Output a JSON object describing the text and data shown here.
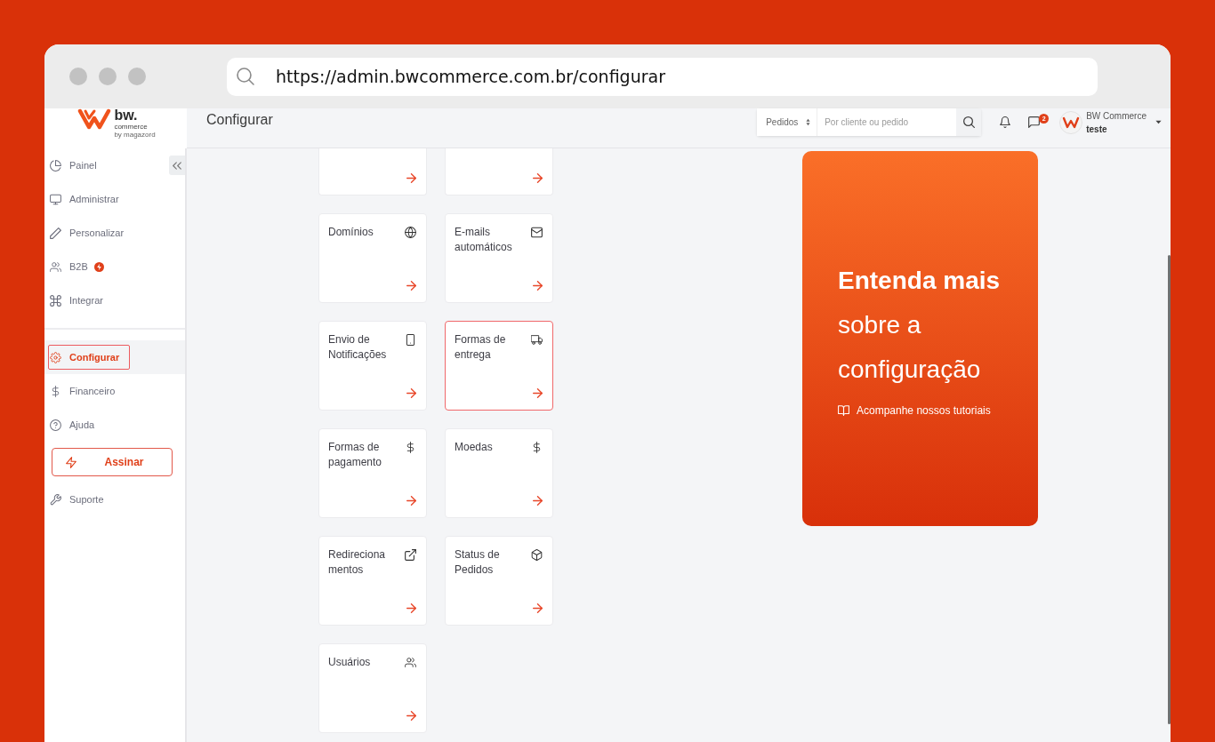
{
  "browser": {
    "url": "https://admin.bwcommerce.com.br/configurar"
  },
  "sidebar": {
    "logo": {
      "wordmark": "bw.",
      "subtitle": "commerce",
      "tagline": "by magazord"
    },
    "sections": [
      {
        "items": [
          {
            "label": "Painel",
            "selected": false,
            "highlighted": false,
            "badge": false
          },
          {
            "label": "Administrar",
            "selected": false,
            "highlighted": false,
            "badge": false
          },
          {
            "label": "Personalizar",
            "selected": false,
            "highlighted": false,
            "badge": false
          },
          {
            "label": "B2B",
            "selected": false,
            "highlighted": false,
            "badge": true
          },
          {
            "label": "Integrar",
            "selected": false,
            "highlighted": false,
            "badge": false
          }
        ]
      },
      {
        "items": [
          {
            "label": "Configurar",
            "selected": true,
            "highlighted": true,
            "badge": false
          },
          {
            "label": "Financeiro",
            "selected": false,
            "highlighted": false,
            "badge": false
          },
          {
            "label": "Ajuda",
            "selected": false,
            "highlighted": false,
            "badge": false
          }
        ]
      }
    ],
    "subscribe_button": "Assinar",
    "footer_items": [
      {
        "label": "Suporte",
        "selected": false,
        "highlighted": false,
        "badge": false
      }
    ]
  },
  "header": {
    "title": "Configurar",
    "search": {
      "scope": "Pedidos",
      "placeholder": "Por cliente ou pedido"
    },
    "messages_badge": "2",
    "account": {
      "name": "BW Commerce",
      "user": "teste"
    }
  },
  "cards": [
    {
      "kind": "clipped",
      "highlighted": false
    },
    {
      "kind": "clipped",
      "highlighted": false
    },
    {
      "kind": "full",
      "title": "Domínios",
      "highlighted": false
    },
    {
      "kind": "full",
      "title": "E-mails automáticos",
      "highlighted": false
    },
    {
      "kind": "full",
      "title": "Envio de Notificações",
      "highlighted": false
    },
    {
      "kind": "full",
      "title": "Formas de entrega",
      "highlighted": true
    },
    {
      "kind": "full",
      "title": "Formas de pagamento",
      "highlighted": false
    },
    {
      "kind": "full",
      "title": "Moedas",
      "highlighted": false
    },
    {
      "kind": "full",
      "title": "Redirecionamentos",
      "highlighted": false
    },
    {
      "kind": "full",
      "title": "Status de Pedidos",
      "highlighted": false
    },
    {
      "kind": "full",
      "title": "Usuários",
      "highlighted": false
    }
  ],
  "promo": {
    "headline": "**Entenda mais** sobre a configuração",
    "link": "Acompanhe nossos tutoriais"
  }
}
